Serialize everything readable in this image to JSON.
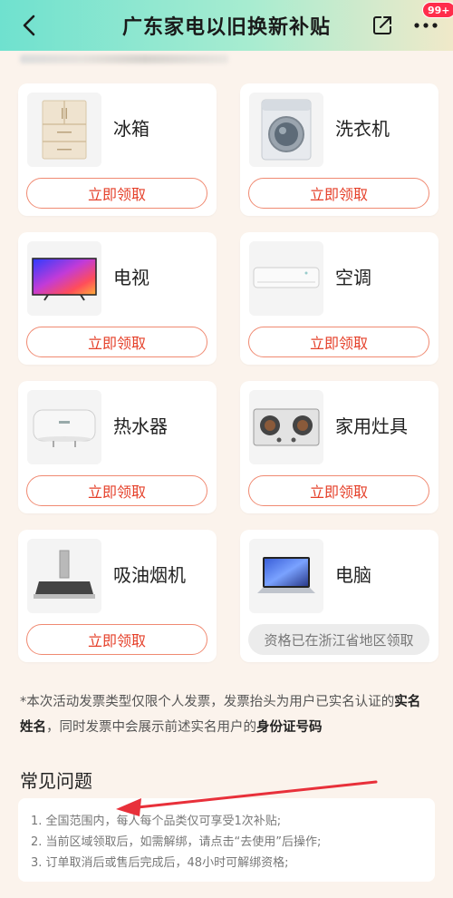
{
  "header": {
    "title": "广东家电以旧换新补贴",
    "badge": "99+"
  },
  "products": [
    {
      "name": "冰箱",
      "button": "立即领取",
      "icon": "fridge-icon",
      "disabled": false
    },
    {
      "name": "洗衣机",
      "button": "立即领取",
      "icon": "washing-machine-icon",
      "disabled": false
    },
    {
      "name": "电视",
      "button": "立即领取",
      "icon": "tv-icon",
      "disabled": false
    },
    {
      "name": "空调",
      "button": "立即领取",
      "icon": "air-conditioner-icon",
      "disabled": false
    },
    {
      "name": "热水器",
      "button": "立即领取",
      "icon": "water-heater-icon",
      "disabled": false
    },
    {
      "name": "家用灶具",
      "button": "立即领取",
      "icon": "gas-stove-icon",
      "disabled": false
    },
    {
      "name": "吸油烟机",
      "button": "立即领取",
      "icon": "range-hood-icon",
      "disabled": false
    },
    {
      "name": "电脑",
      "button": "资格已在浙江省地区领取",
      "icon": "laptop-icon",
      "disabled": true
    }
  ],
  "note": {
    "part1": "*本次活动发票类型仅限个人发票，发票抬头为用户已实名认证的",
    "bold1": "实名姓名",
    "part2": "，同时发票中会展示前述实名用户的",
    "bold2": "身份证号码"
  },
  "faq": {
    "title": "常见问题",
    "items": [
      "1. 全国范围内，每人每个品类仅可享受1次补贴;",
      "2. 当前区域领取后，如需解绑，请点击“去使用”后操作;",
      "3. 订单取消后或售后完成后，48小时可解绑资格;"
    ]
  },
  "colors": {
    "accent": "#e5402a",
    "header_start": "#6fe1cf",
    "header_end": "#f0e9c9",
    "badge": "#ff2d4b",
    "annotation_arrow": "#e8303a"
  }
}
